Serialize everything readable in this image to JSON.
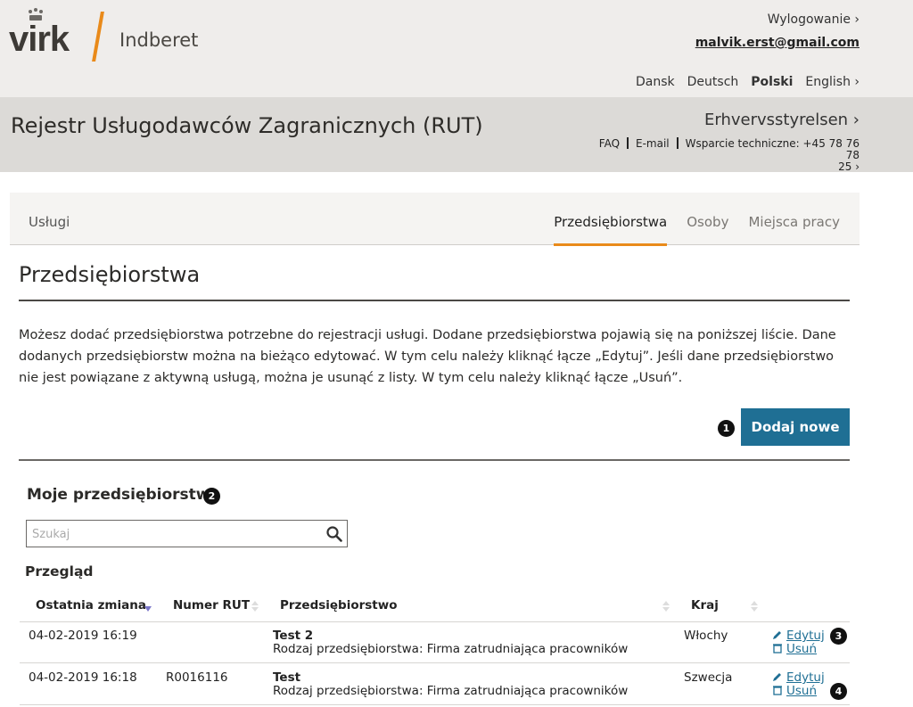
{
  "header": {
    "brand": "virk",
    "sub_brand": "Indberet",
    "logout": "Wylogowanie ›",
    "user_email": "malvik.erst@gmail.com",
    "languages": [
      {
        "label": "Dansk"
      },
      {
        "label": "Deutsch"
      },
      {
        "label": "Polski"
      },
      {
        "label": "English ›"
      }
    ]
  },
  "titlebar": {
    "title": "Rejestr Usługodawców Zagranicznych (RUT)",
    "agency": "Erhvervsstyrelsen ›",
    "faq": "FAQ",
    "email": "E-mail",
    "support": "Wsparcie techniczne: +45 78 76 78",
    "support_cont": "25 ›"
  },
  "nav": {
    "left": "Usługi",
    "tabs": [
      {
        "label": "Przedsiębiorstwa"
      },
      {
        "label": "Osoby"
      },
      {
        "label": "Miejsca pracy"
      }
    ]
  },
  "main": {
    "heading": "Przedsiębiorstwa",
    "intro": "Możesz dodać przedsiębiorstwa potrzebne do rejestracji usługi. Dodane przedsiębiorstwa pojawią się na poniższej liście. Dane dodanych przedsiębiorstw można na bieżąco edytować. W tym celu należy kliknąć łącze „Edytuj”. Jeśli dane przedsiębiorstwo nie jest powiązane z aktywną usługą, można je usunąć z listy. W tym celu należy kliknąć łącze „Usuń”.",
    "add_button": "Dodaj nowe",
    "badge1": "1",
    "section_title": "Moje przedsiębiorstwa",
    "badge2": "2",
    "search_placeholder": "Szukaj",
    "overview": "Przegląd"
  },
  "table": {
    "columns": [
      "Ostatnia zmiana",
      "Numer RUT",
      "Przedsiębiorstwo",
      "Kraj"
    ],
    "rows": [
      {
        "date": "04-02-2019 16:19",
        "rut": "",
        "name": "Test 2",
        "type": "Rodzaj przedsiębiorstwa: Firma zatrudniająca pracowników",
        "country": "Włochy",
        "edit": "Edytuj",
        "delete": "Usuń",
        "badge": "3"
      },
      {
        "date": "04-02-2019 16:18",
        "rut": "R0016116",
        "name": "Test",
        "type": "Rodzaj przedsiębiorstwa: Firma zatrudniająca pracowników",
        "country": "Szwecja",
        "edit": "Edytuj",
        "delete": "Usuń",
        "badge": "4"
      }
    ]
  },
  "colors": {
    "accent_orange": "#e98a1a",
    "button_blue": "#1f6f94",
    "sort_active": "#7b77c9"
  }
}
